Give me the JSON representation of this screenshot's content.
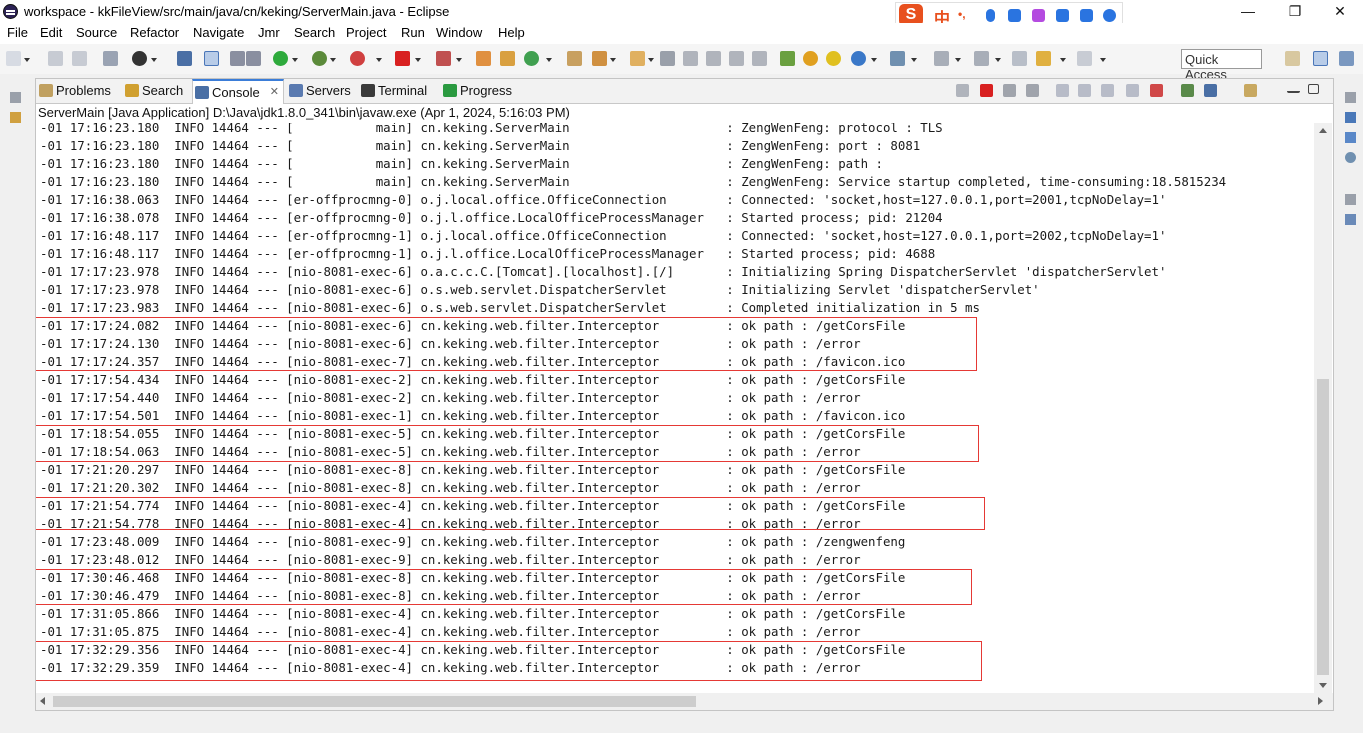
{
  "window": {
    "title": "workspace - kkFileView/src/main/java/cn/keking/ServerMain.java - Eclipse",
    "minimize": "—",
    "maximize": "❐",
    "close": "✕"
  },
  "ime": {
    "logo": "S",
    "mode": "中",
    "punct": "•,"
  },
  "menu": [
    "File",
    "Edit",
    "Source",
    "Refactor",
    "Navigate",
    "Jmr",
    "Search",
    "Project",
    "Run",
    "Window",
    "Help"
  ],
  "quick_access": "Quick Access",
  "tabs": [
    {
      "label": "Problems",
      "icon": "problems-icon"
    },
    {
      "label": "Search",
      "icon": "search-icon"
    },
    {
      "label": "Console",
      "icon": "console-icon",
      "active": true
    },
    {
      "label": "Servers",
      "icon": "servers-icon"
    },
    {
      "label": "Terminal",
      "icon": "terminal-icon"
    },
    {
      "label": "Progress",
      "icon": "progress-icon"
    }
  ],
  "tab_close": "✕",
  "process": "ServerMain [Java Application] D:\\Java\\jdk1.8.0_341\\bin\\javaw.exe (Apr 1, 2024, 5:16:03 PM)",
  "colors": {
    "highlight_box": "#e53935",
    "active_tab_accent": "#3b7dd8"
  },
  "console_lines": [
    "-01 17:16:23.180  INFO 14464 --- [           main] cn.keking.ServerMain                     : ZengWenFeng: protocol : TLS",
    "-01 17:16:23.180  INFO 14464 --- [           main] cn.keking.ServerMain                     : ZengWenFeng: port : 8081",
    "-01 17:16:23.180  INFO 14464 --- [           main] cn.keking.ServerMain                     : ZengWenFeng: path :",
    "-01 17:16:23.180  INFO 14464 --- [           main] cn.keking.ServerMain                     : ZengWenFeng: Service startup completed, time-consuming:18.5815234",
    "-01 17:16:38.063  INFO 14464 --- [er-offprocmng-0] o.j.local.office.OfficeConnection        : Connected: 'socket,host=127.0.0.1,port=2001,tcpNoDelay=1'",
    "-01 17:16:38.078  INFO 14464 --- [er-offprocmng-0] o.j.l.office.LocalOfficeProcessManager   : Started process; pid: 21204",
    "-01 17:16:48.117  INFO 14464 --- [er-offprocmng-1] o.j.local.office.OfficeConnection        : Connected: 'socket,host=127.0.0.1,port=2002,tcpNoDelay=1'",
    "-01 17:16:48.117  INFO 14464 --- [er-offprocmng-1] o.j.l.office.LocalOfficeProcessManager   : Started process; pid: 4688",
    "-01 17:17:23.978  INFO 14464 --- [nio-8081-exec-6] o.a.c.c.C.[Tomcat].[localhost].[/]       : Initializing Spring DispatcherServlet 'dispatcherServlet'",
    "-01 17:17:23.978  INFO 14464 --- [nio-8081-exec-6] o.s.web.servlet.DispatcherServlet        : Initializing Servlet 'dispatcherServlet'",
    "-01 17:17:23.983  INFO 14464 --- [nio-8081-exec-6] o.s.web.servlet.DispatcherServlet        : Completed initialization in 5 ms",
    "-01 17:17:24.082  INFO 14464 --- [nio-8081-exec-6] cn.keking.web.filter.Interceptor         : ok path : /getCorsFile",
    "-01 17:17:24.130  INFO 14464 --- [nio-8081-exec-6] cn.keking.web.filter.Interceptor         : ok path : /error",
    "-01 17:17:24.357  INFO 14464 --- [nio-8081-exec-7] cn.keking.web.filter.Interceptor         : ok path : /favicon.ico",
    "-01 17:17:54.434  INFO 14464 --- [nio-8081-exec-2] cn.keking.web.filter.Interceptor         : ok path : /getCorsFile",
    "-01 17:17:54.440  INFO 14464 --- [nio-8081-exec-2] cn.keking.web.filter.Interceptor         : ok path : /error",
    "-01 17:17:54.501  INFO 14464 --- [nio-8081-exec-1] cn.keking.web.filter.Interceptor         : ok path : /favicon.ico",
    "-01 17:18:54.055  INFO 14464 --- [nio-8081-exec-5] cn.keking.web.filter.Interceptor         : ok path : /getCorsFile",
    "-01 17:18:54.063  INFO 14464 --- [nio-8081-exec-5] cn.keking.web.filter.Interceptor         : ok path : /error",
    "-01 17:21:20.297  INFO 14464 --- [nio-8081-exec-8] cn.keking.web.filter.Interceptor         : ok path : /getCorsFile",
    "-01 17:21:20.302  INFO 14464 --- [nio-8081-exec-8] cn.keking.web.filter.Interceptor         : ok path : /error",
    "-01 17:21:54.774  INFO 14464 --- [nio-8081-exec-4] cn.keking.web.filter.Interceptor         : ok path : /getCorsFile",
    "-01 17:21:54.778  INFO 14464 --- [nio-8081-exec-4] cn.keking.web.filter.Interceptor         : ok path : /error",
    "-01 17:23:48.009  INFO 14464 --- [nio-8081-exec-9] cn.keking.web.filter.Interceptor         : ok path : /zengwenfeng",
    "-01 17:23:48.012  INFO 14464 --- [nio-8081-exec-9] cn.keking.web.filter.Interceptor         : ok path : /error",
    "-01 17:30:46.468  INFO 14464 --- [nio-8081-exec-8] cn.keking.web.filter.Interceptor         : ok path : /getCorsFile",
    "-01 17:30:46.479  INFO 14464 --- [nio-8081-exec-8] cn.keking.web.filter.Interceptor         : ok path : /error",
    "-01 17:31:05.866  INFO 14464 --- [nio-8081-exec-4] cn.keking.web.filter.Interceptor         : ok path : /getCorsFile",
    "-01 17:31:05.875  INFO 14464 --- [nio-8081-exec-4] cn.keking.web.filter.Interceptor         : ok path : /error",
    "-01 17:32:29.356  INFO 14464 --- [nio-8081-exec-4] cn.keking.web.filter.Interceptor         : ok path : /getCorsFile",
    "-01 17:32:29.359  INFO 14464 --- [nio-8081-exec-4] cn.keking.web.filter.Interceptor         : ok path : /error"
  ]
}
